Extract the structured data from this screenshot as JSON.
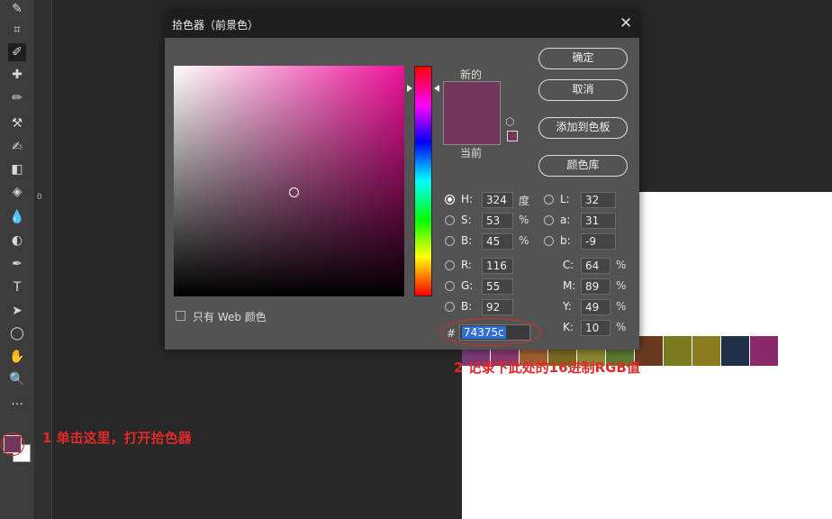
{
  "dialog": {
    "title": "拾色器（前景色）",
    "close_glyph": "✕",
    "new_label": "新的",
    "current_label": "当前",
    "new_color": "#74375c",
    "current_color": "#74375c",
    "cube_glyph": "⬡",
    "buttons": {
      "ok": "确定",
      "cancel": "取消",
      "add_swatch": "添加到色板",
      "color_library": "颜色库"
    },
    "web_only_label": "只有 Web 颜色",
    "hash_label": "#",
    "hex_value": "74375c",
    "hsb": [
      {
        "label": "H:",
        "value": "324",
        "unit": "度",
        "selected": true
      },
      {
        "label": "S:",
        "value": "53",
        "unit": "%",
        "selected": false
      },
      {
        "label": "B:",
        "value": "45",
        "unit": "%",
        "selected": false
      }
    ],
    "lab": [
      {
        "label": "L:",
        "value": "32"
      },
      {
        "label": "a:",
        "value": "31"
      },
      {
        "label": "b:",
        "value": "-9"
      }
    ],
    "rgb": [
      {
        "label": "R:",
        "value": "116"
      },
      {
        "label": "G:",
        "value": "55"
      },
      {
        "label": "B:",
        "value": "92"
      }
    ],
    "cmyk": [
      {
        "label": "C:",
        "value": "64",
        "unit": "%"
      },
      {
        "label": "M:",
        "value": "89",
        "unit": "%"
      },
      {
        "label": "Y:",
        "value": "49",
        "unit": "%"
      },
      {
        "label": "K:",
        "value": "10",
        "unit": "%"
      }
    ],
    "field_hue_color": "#f0129a"
  },
  "ruler_zero": "0",
  "annotations": {
    "step1": "1  单击这里，打开拾色器",
    "step2": "2  记录下此处的16进制RGB值",
    "color": "#e02a2a"
  },
  "toolbar": {
    "icons": [
      "brush-icon",
      "crop-icon",
      "eyedropper-icon",
      "healing-icon",
      "brush-tool-icon",
      "stamp-icon",
      "history-brush-icon",
      "eraser-icon",
      "paint-bucket-icon",
      "blur-icon",
      "dodge-icon",
      "pen-icon",
      "text-icon",
      "path-select-icon",
      "ellipse-icon",
      "hand-icon",
      "zoom-icon",
      "more-icon"
    ],
    "glyphs": [
      "✎",
      "⌗",
      "✐",
      "✚",
      "✏",
      "⚒",
      "✍",
      "◧",
      "◈",
      "💧",
      "◐",
      "✒",
      "T",
      "➤",
      "◯",
      "✋",
      "🔍",
      "···"
    ],
    "foreground_color": "#74375c",
    "background_color": "#ffffff"
  },
  "swatches": [
    "#7a3b78",
    "#8a3a6e",
    "#a06030",
    "#7a6a20",
    "#8a8a30",
    "#5a7a30",
    "#6a3a20",
    "#7a7a20",
    "#8a7a20",
    "#203048",
    "#8a2a6a"
  ]
}
